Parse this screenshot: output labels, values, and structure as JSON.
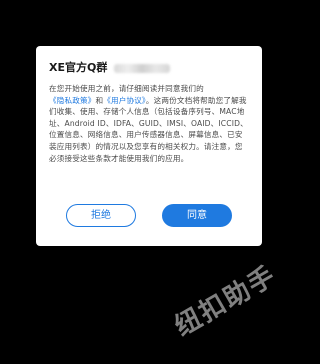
{
  "dialog": {
    "title": "XE官方Q群",
    "body": {
      "before_privacy": "在您开始使用之前，请仔细阅读并同意我们的",
      "privacy_link": "《隐私政策》",
      "and_text": "和",
      "user_agreement_link": "《用户协议》",
      "after_links": "。这两份文档将帮助您了解我们收集、使用、存储个人信息（包括设备序列号、MAC地址、Android ID、IDFA、GUID、IMSI、OAID、ICCID、位置信息、网络信息、用户传感器信息、屏幕信息、已安装应用列表）的情况以及您享有的相关权力。请注意，您必须接受这些条款才能使用我们的应用。"
    },
    "reject_label": "拒绝",
    "agree_label": "同意"
  },
  "watermark": {
    "text": "纽扣助手"
  },
  "colors": {
    "accent": "#1f7ae0",
    "backdrop": "#000000",
    "dialog_bg": "#ffffff"
  }
}
